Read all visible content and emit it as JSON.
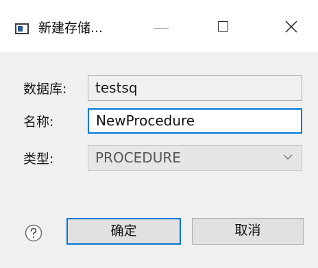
{
  "window": {
    "title": "新建存储..."
  },
  "form": {
    "database_label": "数据库:",
    "database_value": "testsq",
    "name_label": "名称:",
    "name_value": "NewProcedure",
    "type_label": "类型:",
    "type_value": "PROCEDURE"
  },
  "buttons": {
    "ok_label": "确定",
    "cancel_label": "取消"
  },
  "colors": {
    "accent": "#0078d7",
    "titlebar_bg": "#ffffff",
    "dialog_bg": "#f0f0f0"
  }
}
